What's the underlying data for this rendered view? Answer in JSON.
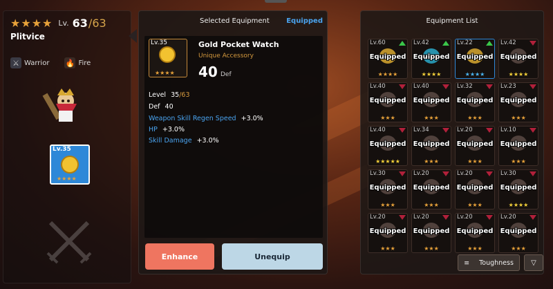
{
  "character": {
    "stars": 4,
    "level_prefix": "Lv.",
    "level_current": "63",
    "level_max": "/63",
    "name": "Plitvice",
    "class": "Warrior",
    "element": "Fire",
    "equipped_slot_level": "Lv.35",
    "equipped_slot_stars": "★★★★"
  },
  "selected": {
    "title": "Selected Equipment",
    "status": "Equipped",
    "item_level": "Lv.35",
    "item_stars": "★★★★",
    "name": "Gold Pocket Watch",
    "rarity": "Unique Accessory",
    "main_stat_value": "40",
    "main_stat_label": "Def",
    "level_label": "Level",
    "level_value": "35",
    "level_max": "/63",
    "def_label": "Def",
    "def_value": "40",
    "sub_stats": [
      {
        "label": "Weapon Skill Regen Speed",
        "value": "+3.0%"
      },
      {
        "label": "HP",
        "value": "+3.0%"
      },
      {
        "label": "Skill Damage",
        "value": "+3.0%"
      }
    ],
    "enhance_label": "Enhance",
    "unequip_label": "Unequip"
  },
  "list": {
    "title": "Equipment List",
    "items": [
      {
        "lv": "Lv.60",
        "label": "Equipped",
        "stars": "★★★★",
        "star_color": "orange",
        "gem": "up",
        "art": "gold"
      },
      {
        "lv": "Lv.42",
        "label": "Equipped",
        "stars": "★★★★",
        "star_color": "yellow",
        "gem": "up",
        "art": "cyan"
      },
      {
        "lv": "Lv.22",
        "label": "Equipped",
        "stars": "★★★★",
        "star_color": "blue",
        "gem": "up",
        "art": "gold"
      },
      {
        "lv": "Lv.42",
        "label": "Equipped",
        "stars": "★★★★",
        "star_color": "yellow",
        "gem": "down",
        "art": "grey"
      },
      {
        "lv": "Lv.40",
        "label": "Equipped",
        "stars": "★★★",
        "star_color": "orange",
        "gem": "down",
        "art": "grey"
      },
      {
        "lv": "Lv.40",
        "label": "Equipped",
        "stars": "★★★",
        "star_color": "orange",
        "gem": "down",
        "art": "grey"
      },
      {
        "lv": "Lv.32",
        "label": "Equipped",
        "stars": "★★★",
        "star_color": "orange",
        "gem": "down",
        "art": "grey"
      },
      {
        "lv": "Lv.23",
        "label": "Equipped",
        "stars": "★★★",
        "star_color": "orange",
        "gem": "down",
        "art": "grey"
      },
      {
        "lv": "Lv.40",
        "label": "Equipped",
        "stars": "★★★★★",
        "star_color": "yellow",
        "gem": "down",
        "art": "grey"
      },
      {
        "lv": "Lv.34",
        "label": "Equipped",
        "stars": "★★★",
        "star_color": "orange",
        "gem": "down",
        "art": "grey"
      },
      {
        "lv": "Lv.20",
        "label": "Equipped",
        "stars": "★★★",
        "star_color": "orange",
        "gem": "down",
        "art": "grey"
      },
      {
        "lv": "Lv.10",
        "label": "Equipped",
        "stars": "★★★",
        "star_color": "orange",
        "gem": "down",
        "art": "grey"
      },
      {
        "lv": "Lv.30",
        "label": "Equipped",
        "stars": "★★★",
        "star_color": "orange",
        "gem": "down",
        "art": "grey"
      },
      {
        "lv": "Lv.20",
        "label": "Equipped",
        "stars": "★★★",
        "star_color": "orange",
        "gem": "down",
        "art": "grey"
      },
      {
        "lv": "Lv.20",
        "label": "Equipped",
        "stars": "★★★",
        "star_color": "orange",
        "gem": "down",
        "art": "grey"
      },
      {
        "lv": "Lv.30",
        "label": "Equipped",
        "stars": "★★★★",
        "star_color": "yellow",
        "gem": "down",
        "art": "grey"
      },
      {
        "lv": "Lv.20",
        "label": "Equipped",
        "stars": "★★★",
        "star_color": "orange",
        "gem": "down",
        "art": "grey"
      },
      {
        "lv": "Lv.20",
        "label": "Equipped",
        "stars": "★★★",
        "star_color": "orange",
        "gem": "down",
        "art": "grey"
      },
      {
        "lv": "Lv.20",
        "label": "Equipped",
        "stars": "★★★",
        "star_color": "orange",
        "gem": "down",
        "art": "grey"
      },
      {
        "lv": "Lv.20",
        "label": "Equipped",
        "stars": "★★★",
        "star_color": "orange",
        "gem": "down",
        "art": "grey"
      }
    ],
    "sort_icon": "list-icon",
    "sort_label": "Toughness",
    "filter_icon": "filter-triangle-icon"
  },
  "colors": {
    "accent_blue": "#4aa4f0",
    "enhance": "#ef7560",
    "unequip": "#bdd7e6",
    "star_orange": "#e8a23a"
  }
}
